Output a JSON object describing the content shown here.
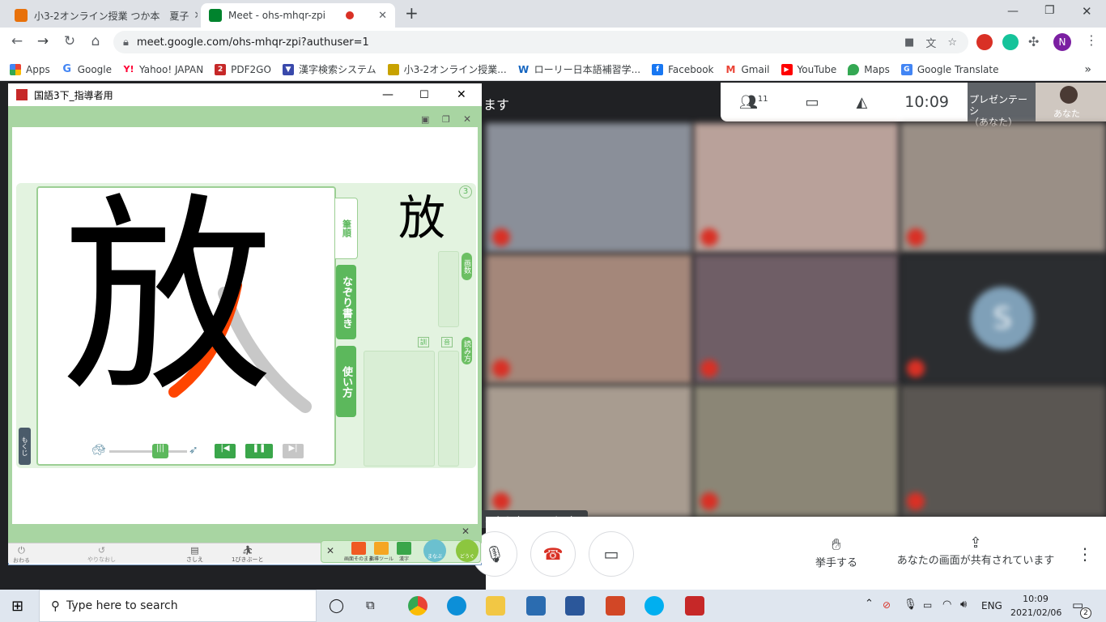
{
  "browser": {
    "tabs": [
      {
        "title": "小3-2オンライン授業 つか本　夏子",
        "favicon_color": "#e8710a"
      },
      {
        "title": "Meet - ohs-mhqr-zpi",
        "favicon_color": "#00832d"
      }
    ],
    "new_tab": "+",
    "url": "meet.google.com/ohs-mhqr-zpi?authuser=1",
    "profile_initial": "N",
    "bookmarks": [
      {
        "label": "Apps",
        "icon": "apps-grid-icon"
      },
      {
        "label": "Google",
        "icon": "google-icon"
      },
      {
        "label": "Yahoo! JAPAN",
        "icon": "yahoo-icon"
      },
      {
        "label": "PDF2GO",
        "icon": "pdf2go-icon"
      },
      {
        "label": "漢字検索システム",
        "icon": "kanji-icon"
      },
      {
        "label": "小3-2オンライン授業...",
        "icon": "classroom-icon"
      },
      {
        "label": "ローリー日本語補習学...",
        "icon": "w-icon"
      },
      {
        "label": "Facebook",
        "icon": "facebook-icon"
      },
      {
        "label": "Gmail",
        "icon": "gmail-icon"
      },
      {
        "label": "YouTube",
        "icon": "youtube-icon"
      },
      {
        "label": "Maps",
        "icon": "maps-icon"
      },
      {
        "label": "Google Translate",
        "icon": "translate-icon"
      }
    ],
    "bookmarks_more": "»"
  },
  "meet": {
    "participants_count": "11",
    "time": "10:09",
    "presentation_label": "プレゼンテーシ",
    "presentation_sub": "（あなた）",
    "self_label": "あなた",
    "side_text": "ます",
    "tooltip": "こする（Ctrl+D キー）",
    "raise_hand_label": "挙手する",
    "sharing_label": "あなたの画面が共有されています",
    "tile_initial": "S",
    "tile_colors": [
      "#8a8f99",
      "#b9a19a",
      "#9a8f86",
      "#a4877a",
      "#6f5e66",
      "#2b2d30",
      "#a89c90",
      "#8b8676",
      "#5a5652"
    ]
  },
  "kanji_app": {
    "window_title": "国語3下_指導者用",
    "kanji": "放",
    "page_number": "3",
    "tab_stroke_order": "筆順",
    "tab_trace": "なぞり書き",
    "tab_usage": "使い方",
    "label_strokes": "画数",
    "label_readings": "読み方",
    "label_kun": "訓",
    "label_on": "音",
    "menu_label": "もくじ",
    "speed_slow_icon": "turtle-icon",
    "speed_fast_icon": "rabbit-icon",
    "bottom_buttons": [
      "おわる",
      "やりなおし",
      "さしえ",
      "1ぴきぶーと"
    ],
    "tools": [
      "画面そのまま",
      "指導ツール",
      "漢字",
      "まなぶ",
      "どうぐ"
    ]
  },
  "taskbar": {
    "search_placeholder": "Type here to search",
    "lang": "ENG",
    "time": "10:09",
    "date": "2021/02/06",
    "notifications": "2"
  }
}
